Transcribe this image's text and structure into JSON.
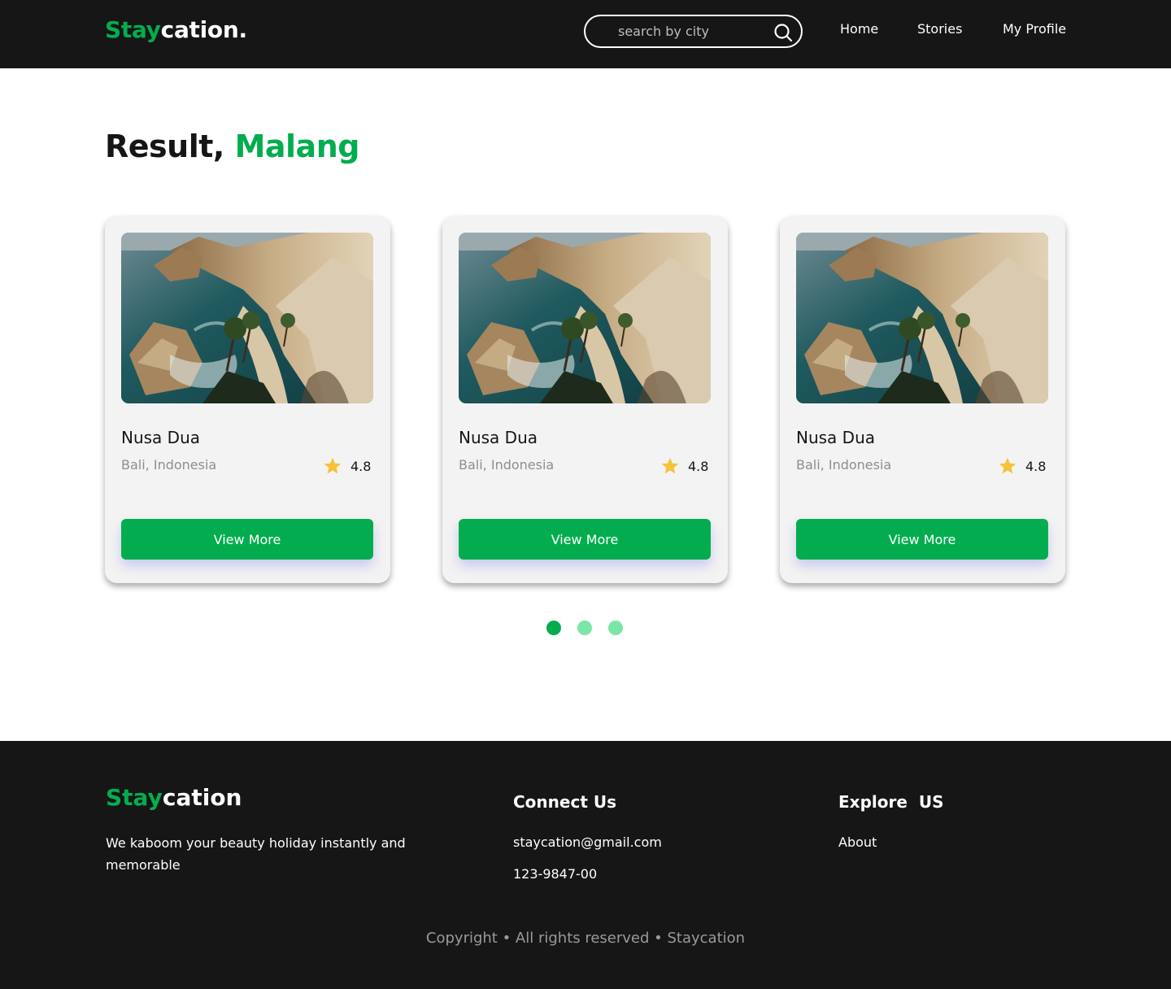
{
  "header": {
    "logo_accent": "Stay",
    "logo_rest": "cation.",
    "search_placeholder": "search by city",
    "nav": [
      "Home",
      "Stories",
      "My Profile"
    ]
  },
  "result": {
    "prefix": "Result,",
    "city": "Malang"
  },
  "cards": [
    {
      "title": "Nusa Dua",
      "location": "Bali, Indonesia",
      "rating": "4.8",
      "button": "View More"
    },
    {
      "title": "Nusa Dua",
      "location": "Bali, Indonesia",
      "rating": "4.8",
      "button": "View More"
    },
    {
      "title": "Nusa Dua",
      "location": "Bali, Indonesia",
      "rating": "4.8",
      "button": "View More"
    }
  ],
  "pagination": {
    "total": 3,
    "active": 1
  },
  "footer": {
    "logo_accent": "Stay",
    "logo_rest": "cation",
    "tagline": "We kaboom your beauty holiday instantly and memorable",
    "connect_heading": "Connect Us",
    "email": "staycation@gmail.com",
    "phone": "123-9847-00",
    "explore_heading": "Explore  US",
    "explore_links": [
      "About"
    ],
    "copyright": "Copyright • All rights reserved • Staycation"
  },
  "colors": {
    "brand_green": "#03ad4f",
    "dark_bg": "#161616",
    "card_bg": "#f3f3f3",
    "star_yellow": "#f5c33b",
    "dot_inactive": "#7ae6a8"
  },
  "icons": [
    "search-icon",
    "star-icon",
    "beach-photo"
  ]
}
